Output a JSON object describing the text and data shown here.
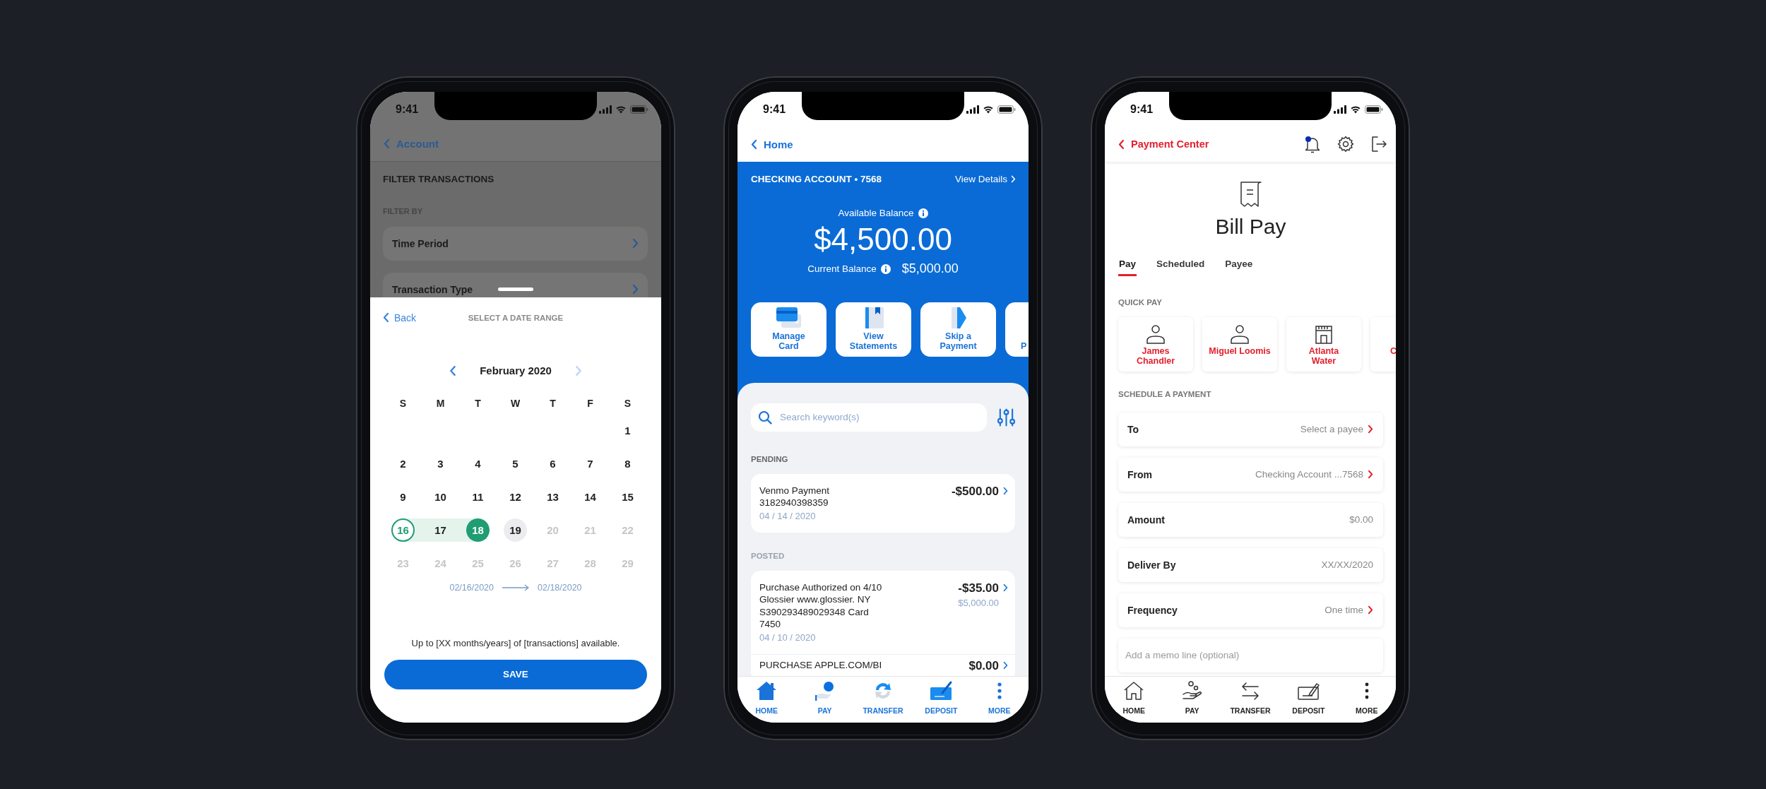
{
  "phones": [
    {
      "kind": "date_filter",
      "status_time": "9:41",
      "nav": {
        "back": "Account"
      },
      "title": "FILTER TRANSACTIONS",
      "section": "FILTER BY",
      "filters": [
        {
          "label": "Time Period"
        },
        {
          "label": "Transaction Type"
        }
      ],
      "sheet": {
        "back": "Back",
        "title": "SELECT A DATE RANGE",
        "month": "February 2020",
        "prev_disabled": false,
        "next_disabled": true,
        "weekdays": [
          "S",
          "M",
          "T",
          "W",
          "T",
          "F",
          "S"
        ],
        "weeks": [
          [
            {
              "kind": "blank"
            },
            {
              "kind": "blank"
            },
            {
              "kind": "blank"
            },
            {
              "kind": "blank"
            },
            {
              "kind": "blank"
            },
            {
              "kind": "blank"
            },
            {
              "day": "1",
              "kind": "normal"
            }
          ],
          [
            {
              "day": "2",
              "kind": "normal"
            },
            {
              "day": "3",
              "kind": "normal"
            },
            {
              "day": "4",
              "kind": "normal"
            },
            {
              "day": "5",
              "kind": "normal"
            },
            {
              "day": "6",
              "kind": "normal"
            },
            {
              "day": "7",
              "kind": "normal"
            },
            {
              "day": "8",
              "kind": "normal"
            }
          ],
          [
            {
              "day": "9",
              "kind": "normal"
            },
            {
              "day": "10",
              "kind": "normal"
            },
            {
              "day": "11",
              "kind": "normal"
            },
            {
              "day": "12",
              "kind": "normal"
            },
            {
              "day": "13",
              "kind": "normal"
            },
            {
              "day": "14",
              "kind": "normal"
            },
            {
              "day": "15",
              "kind": "normal"
            }
          ],
          [
            {
              "day": "16",
              "kind": "range_start"
            },
            {
              "day": "17",
              "kind": "in_range"
            },
            {
              "day": "18",
              "kind": "range_end"
            },
            {
              "day": "19",
              "kind": "today"
            },
            {
              "day": "20",
              "kind": "disabled"
            },
            {
              "day": "21",
              "kind": "disabled"
            },
            {
              "day": "22",
              "kind": "disabled"
            }
          ],
          [
            {
              "day": "23",
              "kind": "disabled"
            },
            {
              "day": "24",
              "kind": "disabled"
            },
            {
              "day": "25",
              "kind": "disabled"
            },
            {
              "day": "26",
              "kind": "disabled"
            },
            {
              "day": "27",
              "kind": "disabled"
            },
            {
              "day": "28",
              "kind": "disabled"
            },
            {
              "day": "29",
              "kind": "disabled"
            }
          ]
        ],
        "range_from": "02/16/2020",
        "range_to": "02/18/2020",
        "note": "Up to [XX months/years] of [transactions] available.",
        "button": "SAVE"
      }
    },
    {
      "kind": "account",
      "status_time": "9:41",
      "nav": {
        "back": "Home"
      },
      "account": {
        "name": "CHECKING ACCOUNT • 7568",
        "details_link": "View Details",
        "available_label": "Available Balance",
        "available": "$4,500.00",
        "current_label": "Current Balance",
        "current": "$5,000.00"
      },
      "actions": [
        {
          "label": "Manage\nCard",
          "kind": "tile"
        },
        {
          "label": "View\nStatements",
          "kind": "tile"
        },
        {
          "label": "Skip a\nPayment",
          "kind": "tile"
        },
        {
          "label": "P",
          "kind": "partial"
        }
      ],
      "search": {
        "placeholder": "Search keyword(s)"
      },
      "sections": [
        {
          "title": "PENDING",
          "muted": false,
          "items": [
            {
              "description": "Venmo Payment\n3182940398359",
              "date": "04 / 14 / 2020",
              "amount": "-$500.00"
            }
          ]
        },
        {
          "title": "POSTED",
          "muted": true,
          "items": [
            {
              "description": "Purchase Authorized on 4/10\nGlossier www.glossier. NY\nS390293489029348 Card\n7450",
              "date": "04 / 10 / 2020",
              "amount": "-$35.00",
              "balance": "$5,000.00"
            },
            {
              "description": "PURCHASE APPLE.COM/BI",
              "amount": "$0.00"
            }
          ]
        }
      ],
      "tabbar": [
        {
          "label": "HOME"
        },
        {
          "label": "PAY"
        },
        {
          "label": "TRANSFER"
        },
        {
          "label": "DEPOSIT"
        },
        {
          "label": "MORE"
        }
      ]
    },
    {
      "kind": "bill_pay",
      "status_time": "9:41",
      "nav": {
        "back": "Payment Center",
        "notification": true
      },
      "title": "Bill Pay",
      "tabs": [
        {
          "label": "Pay",
          "selected": true
        },
        {
          "label": "Scheduled",
          "selected": false
        },
        {
          "label": "Payee",
          "selected": false
        }
      ],
      "quick_pay": {
        "title": "QUICK PAY",
        "payees": [
          {
            "name": "James\nChandler",
            "kind": "tile"
          },
          {
            "name": "Miguel Loomis",
            "kind": "tile"
          },
          {
            "name": "Atlanta\nWater",
            "kind": "tile"
          },
          {
            "name": "C",
            "kind": "partial"
          }
        ]
      },
      "schedule": {
        "title": "SCHEDULE A PAYMENT",
        "rows": [
          {
            "label": "To",
            "value": "Select a payee",
            "chevron": true
          },
          {
            "label": "From",
            "value": "Checking Account ...7568",
            "chevron": true
          },
          {
            "label": "Amount",
            "value": "$0.00",
            "chevron": false
          },
          {
            "label": "Deliver By",
            "value": "XX/XX/2020",
            "chevron": false
          },
          {
            "label": "Frequency",
            "value": "One time",
            "chevron": true
          }
        ],
        "memo": {
          "placeholder": "Add a memo line (optional)"
        }
      },
      "tabbar": [
        {
          "label": "HOME"
        },
        {
          "label": "PAY"
        },
        {
          "label": "TRANSFER"
        },
        {
          "label": "DEPOSIT"
        },
        {
          "label": "MORE"
        }
      ]
    }
  ]
}
